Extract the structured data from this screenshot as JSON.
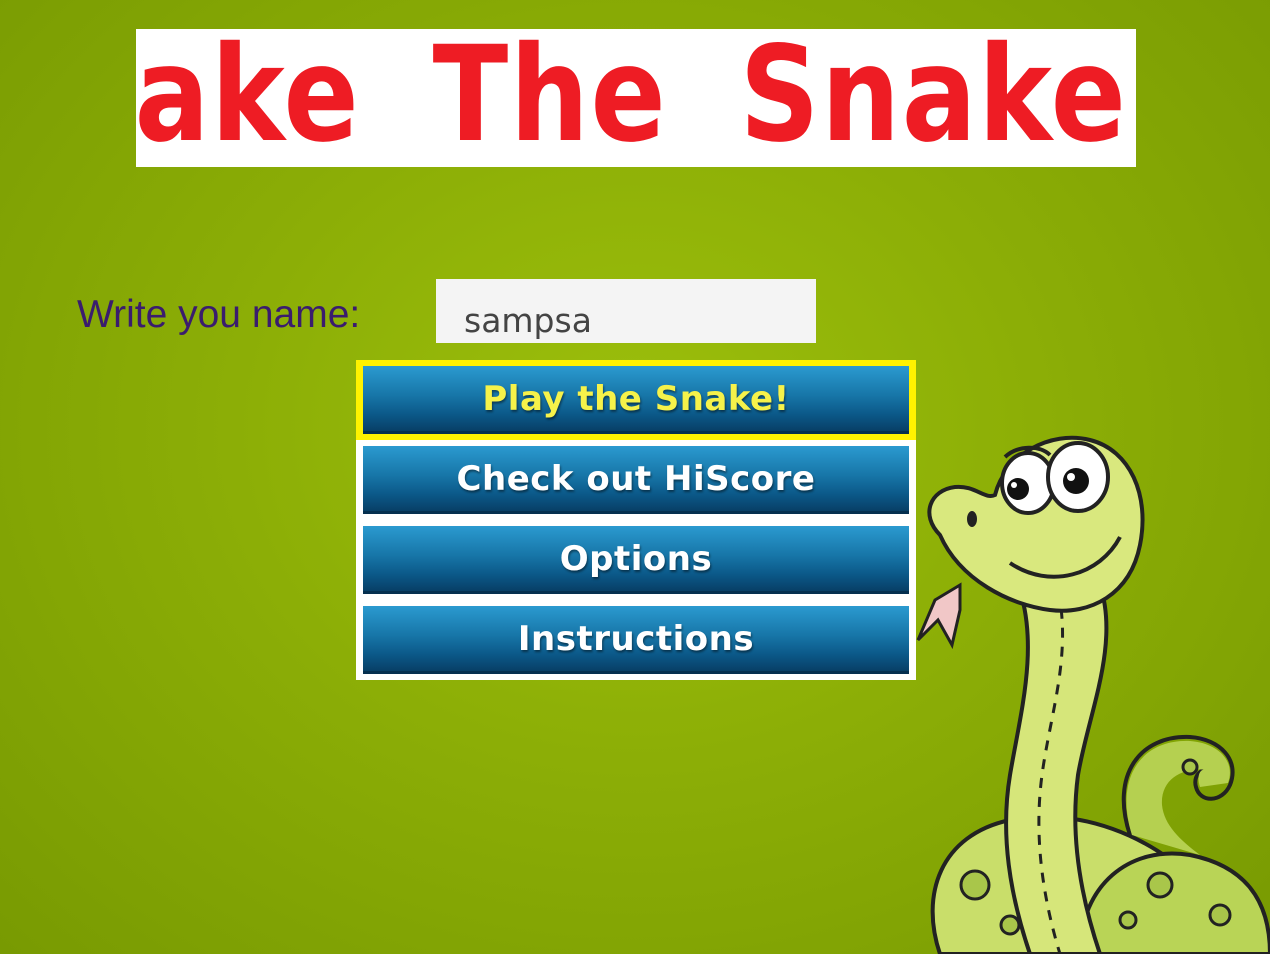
{
  "game": {
    "title": "Jake The Snake!"
  },
  "name_entry": {
    "label": "Write you name:",
    "value": "sampsa"
  },
  "menu": {
    "items": [
      {
        "label": "Play the Snake!",
        "selected": true
      },
      {
        "label": "Check out HiScore",
        "selected": false
      },
      {
        "label": "Options",
        "selected": false
      },
      {
        "label": "Instructions",
        "selected": false
      }
    ]
  },
  "colors": {
    "background": "#8cae06",
    "title_text": "#ee1c24",
    "button": "#1776a8",
    "selected_border": "#fff200",
    "selected_text": "#f6f24a",
    "label_text": "#3a1c6e"
  },
  "icons": {
    "mascot": "cartoon-snake-icon"
  }
}
